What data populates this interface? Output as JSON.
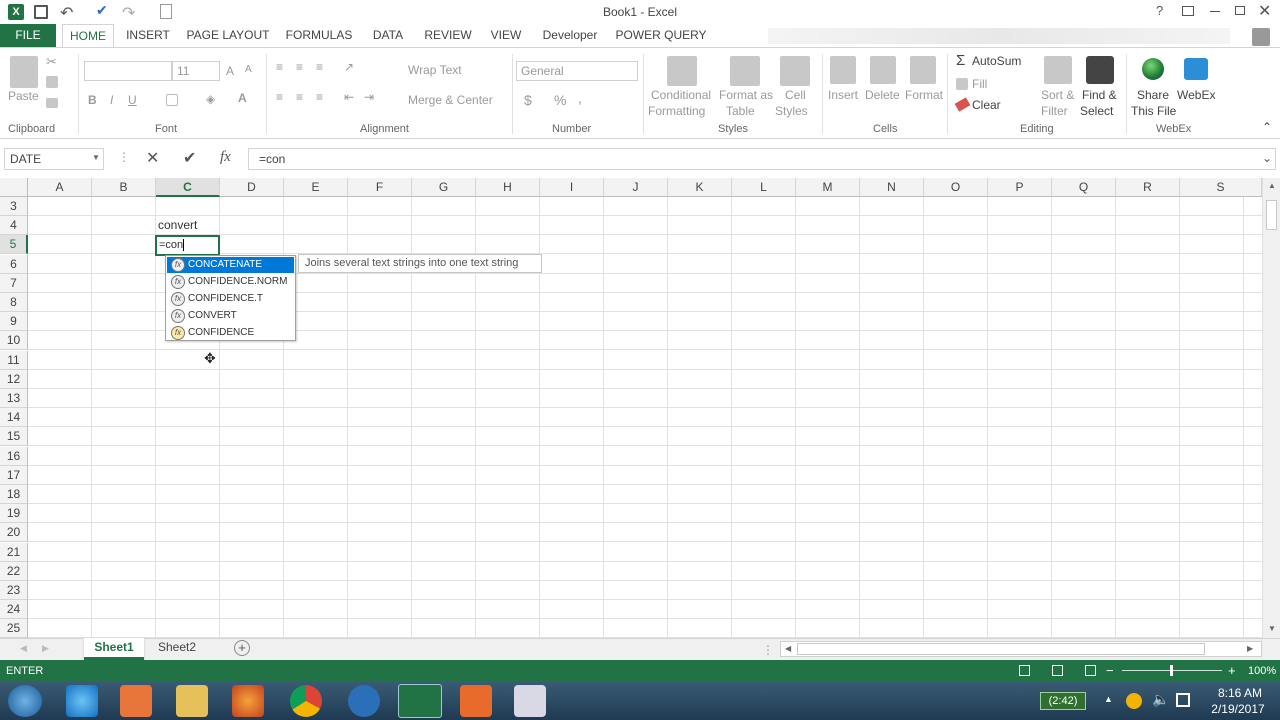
{
  "titlebar": {
    "title": "Book1 - Excel",
    "help": "?"
  },
  "tabs": [
    "FILE",
    "HOME",
    "INSERT",
    "PAGE LAYOUT",
    "FORMULAS",
    "DATA",
    "REVIEW",
    "VIEW",
    "Developer",
    "POWER QUERY"
  ],
  "ribbon": {
    "clipboard": {
      "paste": "Paste",
      "label": "Clipboard"
    },
    "font": {
      "name": "",
      "size": "11",
      "label": "Font"
    },
    "alignment": {
      "wrap": "Wrap Text",
      "merge": "Merge & Center",
      "label": "Alignment"
    },
    "number": {
      "format": "General",
      "label": "Number"
    },
    "styles": {
      "cond1": "Conditional",
      "cond2": "Formatting",
      "fmt1": "Format as",
      "fmt2": "Table",
      "cell1": "Cell",
      "cell2": "Styles",
      "label": "Styles"
    },
    "cells": {
      "insert": "Insert",
      "delete": "Delete",
      "format": "Format",
      "label": "Cells"
    },
    "editing": {
      "autosum": "AutoSum",
      "fill": "Fill",
      "clear": "Clear",
      "sort1": "Sort &",
      "sort2": "Filter",
      "find1": "Find &",
      "find2": "Select",
      "label": "Editing"
    },
    "webex": {
      "share1": "Share",
      "share2": "This File",
      "webex": "WebEx",
      "label": "WebEx"
    }
  },
  "formula_bar": {
    "name_box": "DATE",
    "fx": "fx",
    "formula": "=con"
  },
  "columns": [
    "A",
    "B",
    "C",
    "D",
    "E",
    "F",
    "G",
    "H",
    "I",
    "J",
    "K",
    "L",
    "M",
    "N",
    "O",
    "P",
    "Q",
    "R",
    "S"
  ],
  "rows": [
    "3",
    "4",
    "5",
    "6",
    "7",
    "8",
    "9",
    "10",
    "11",
    "12",
    "13",
    "14",
    "15",
    "16",
    "17",
    "18",
    "19",
    "20",
    "21",
    "22",
    "23",
    "24",
    "25"
  ],
  "cells": {
    "c4": "convert",
    "c5": "=con"
  },
  "autocomplete": {
    "items": [
      "CONCATENATE",
      "CONFIDENCE.NORM",
      "CONFIDENCE.T",
      "CONVERT",
      "CONFIDENCE"
    ],
    "tooltip": "Joins several text strings into one text string"
  },
  "sheets": [
    "Sheet1",
    "Sheet2"
  ],
  "status": {
    "mode": "ENTER",
    "zoom": "100%"
  },
  "taskbar": {
    "battery": "(2:42)",
    "time": "8:16 AM",
    "date": "2/19/2017"
  },
  "colors": {
    "accent": "#217346",
    "selection": "#0078d7"
  }
}
